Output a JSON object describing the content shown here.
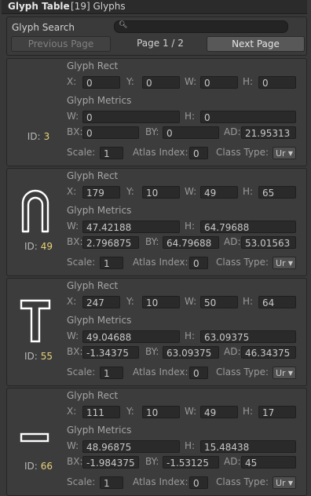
{
  "header": {
    "title": "Glyph Table",
    "count": "[19] Glyphs"
  },
  "search": {
    "label": "Glyph Search",
    "value": ""
  },
  "paging": {
    "prev_label": "Previous Page",
    "page_text": "Page 1 / 2",
    "next_label": "Next Page"
  },
  "labels": {
    "rect": "Glyph Rect",
    "metrics": "Glyph Metrics",
    "x": "X:",
    "y": "Y:",
    "w": "W:",
    "h": "H:",
    "bx": "BX:",
    "by": "BY:",
    "ad": "AD:",
    "scale": "Scale:",
    "atlas": "Atlas Index:",
    "class": "Class Type:",
    "id": "ID:"
  },
  "glyphs": [
    {
      "id": "3",
      "shape": "none",
      "rect": {
        "x": "0",
        "y": "0",
        "w": "0",
        "h": "0"
      },
      "metrics": {
        "w": "0",
        "h": "0",
        "bx": "0",
        "by": "0",
        "ad": "21.95313"
      },
      "scale": "1",
      "atlas": "0",
      "class": "Ur"
    },
    {
      "id": "49",
      "shape": "n",
      "rect": {
        "x": "179",
        "y": "10",
        "w": "49",
        "h": "65"
      },
      "metrics": {
        "w": "47.42188",
        "h": "64.79688",
        "bx": "2.796875",
        "by": "64.79688",
        "ad": "53.01563"
      },
      "scale": "1",
      "atlas": "0",
      "class": "Ur"
    },
    {
      "id": "55",
      "shape": "T",
      "rect": {
        "x": "247",
        "y": "10",
        "w": "50",
        "h": "64"
      },
      "metrics": {
        "w": "49.04688",
        "h": "63.09375",
        "bx": "-1.34375",
        "by": "63.09375",
        "ad": "46.34375"
      },
      "scale": "1",
      "atlas": "0",
      "class": "Ur"
    },
    {
      "id": "66",
      "shape": "dash",
      "rect": {
        "x": "111",
        "y": "10",
        "w": "49",
        "h": "17"
      },
      "metrics": {
        "w": "48.96875",
        "h": "15.48438",
        "bx": "-1.984375",
        "by": "-1.53125",
        "ad": "45"
      },
      "scale": "1",
      "atlas": "0",
      "class": "Ur"
    }
  ]
}
